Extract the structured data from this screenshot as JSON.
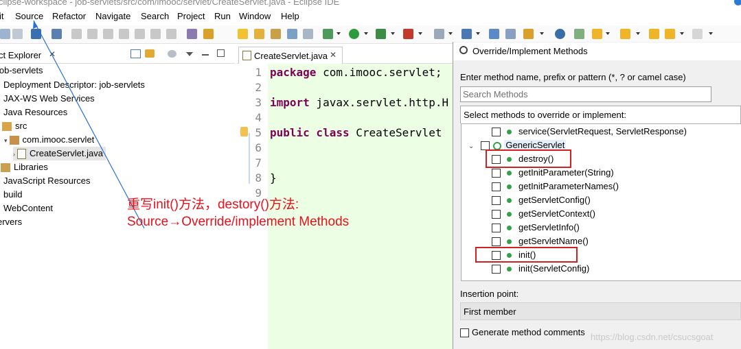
{
  "window": {
    "title": "clipse-workspace - job-servlets/src/com/imooc/servlet/CreateServlet.java - Eclipse IDE"
  },
  "menu": [
    "it",
    "Source",
    "Refactor",
    "Navigate",
    "Search",
    "Project",
    "Run",
    "Window",
    "Help"
  ],
  "project_explorer": {
    "tab_label": "ct Explorer",
    "tree": [
      {
        "label": "job-servlets",
        "icon": "project-icon"
      },
      {
        "label": "Deployment Descriptor: job-servlets",
        "icon": "descriptor-icon"
      },
      {
        "label": "JAX-WS Web Services",
        "icon": "webservice-icon"
      },
      {
        "label": "Java Resources",
        "icon": "java-resources-icon"
      },
      {
        "label": "src",
        "icon": "source-folder-icon"
      },
      {
        "label": "com.imooc.servlet",
        "icon": "package-icon"
      },
      {
        "label": "CreateServlet.java",
        "icon": "java-file-icon"
      },
      {
        "label": "Libraries",
        "icon": "libraries-icon"
      },
      {
        "label": "JavaScript Resources",
        "icon": "js-resources-icon"
      },
      {
        "label": "build",
        "icon": "folder-icon"
      },
      {
        "label": "WebContent",
        "icon": "folder-icon"
      },
      {
        "label": "ervers",
        "icon": "servers-icon"
      }
    ]
  },
  "editor": {
    "tab_label": "CreateServlet.java",
    "lines": [
      {
        "num": "1",
        "kw": "package",
        "text": " com.imooc.servlet;"
      },
      {
        "num": "2",
        "kw": "",
        "text": ""
      },
      {
        "num": "3",
        "kw": "import",
        "text": " javax.servlet.http.H"
      },
      {
        "num": "4",
        "kw": "",
        "text": ""
      },
      {
        "num": "5",
        "kw": "public class",
        "text": " CreateServlet"
      },
      {
        "num": "6",
        "kw": "",
        "text": ""
      },
      {
        "num": "7",
        "kw": "",
        "text": ""
      },
      {
        "num": "8",
        "kw": "",
        "text": "}"
      },
      {
        "num": "9",
        "kw": "",
        "text": ""
      }
    ]
  },
  "dialog": {
    "title": "Override/Implement Methods",
    "filter_label": "Enter method name, prefix or pattern (*, ? or camel case)",
    "search_placeholder": "Search Methods",
    "select_label": "Select methods to override or implement:",
    "methods": [
      "service(ServletRequest, ServletResponse)",
      "GenericServlet",
      "destroy()",
      "getInitParameter(String)",
      "getInitParameterNames()",
      "getServletConfig()",
      "getServletContext()",
      "getServletInfo()",
      "getServletName()",
      "init()",
      "init(ServletConfig)"
    ],
    "insertion_label": "Insertion point:",
    "insertion_value": "First member",
    "generate_comments_label": "Generate method comments"
  },
  "annotation": {
    "line1": "重写init()方法，destory()方法:",
    "line2": "Source→Override/implement Methods"
  },
  "watermark": "https://blog.csdn.net/csucsgoat",
  "colors": {
    "annotation_red": "#e8101a",
    "keyword": "#7f0055",
    "editor_bg": "#ecffe4",
    "method_dot": "#35a04a"
  }
}
